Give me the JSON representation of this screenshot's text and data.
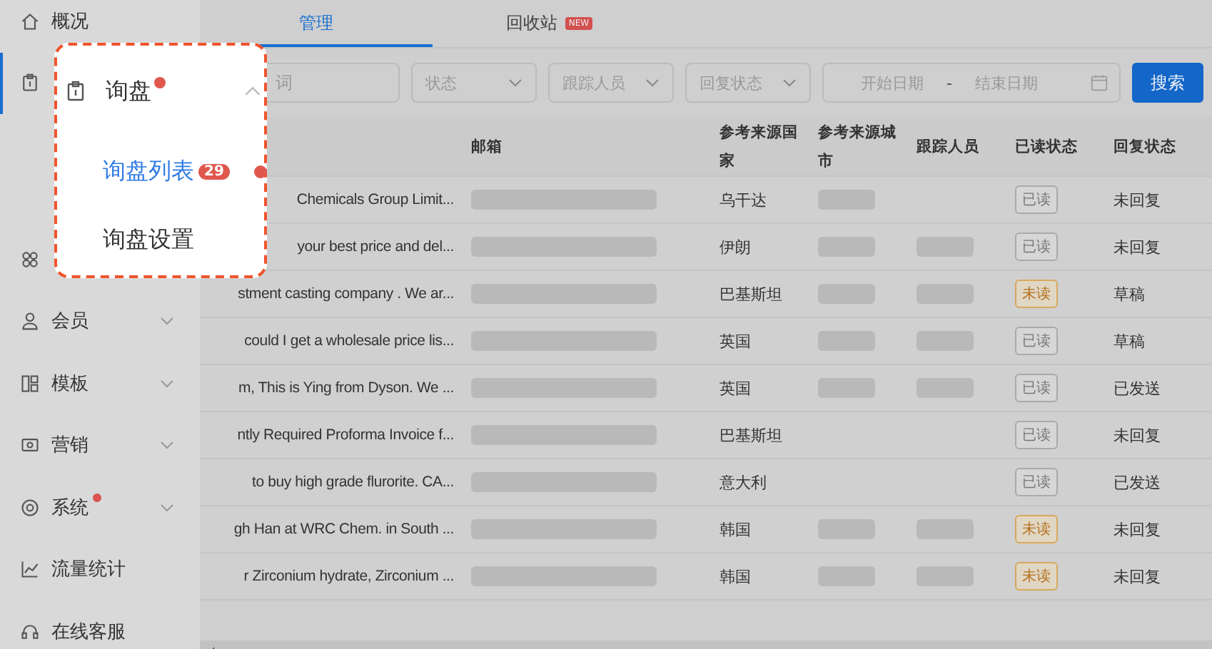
{
  "sidebar": {
    "items": [
      {
        "label": "概况",
        "selected": false,
        "submenu": false,
        "dot": false
      },
      {
        "selected": true
      },
      {
        "selected": false
      },
      {
        "label": "会员",
        "selected": false,
        "submenu": true,
        "dot": false
      },
      {
        "label": "模板",
        "selected": false,
        "submenu": true,
        "dot": false
      },
      {
        "label": "营销",
        "selected": false,
        "submenu": true,
        "dot": false
      },
      {
        "label": "系统",
        "selected": false,
        "submenu": true,
        "dot": true
      },
      {
        "label": "流量统计",
        "selected": false,
        "submenu": false,
        "dot": false
      },
      {
        "label": "在线客服",
        "selected": false,
        "submenu": false,
        "dot": false
      }
    ]
  },
  "popup_menu": {
    "label": "询盘",
    "dot": true,
    "expanded": true,
    "children": [
      {
        "label": "询盘列表",
        "badge": "29",
        "selected": true,
        "dot": true
      },
      {
        "label": "询盘设置",
        "selected": false,
        "dot": false
      }
    ]
  },
  "tabs": [
    {
      "label": "管理",
      "selected": true
    },
    {
      "label": "回收站",
      "badge": "NEW",
      "selected": false
    }
  ],
  "filters": {
    "keyword": {
      "placeholder": "词"
    },
    "selects": [
      {
        "placeholder": "状态"
      },
      {
        "placeholder": "跟踪人员"
      },
      {
        "placeholder": "回复状态"
      }
    ],
    "date_range": {
      "start_placeholder": "开始日期",
      "separator": "-",
      "end_placeholder": "结束日期"
    },
    "search_button": "搜索"
  },
  "table": {
    "columns": [
      "邮箱",
      "参考来源国家",
      "参考来源城市",
      "跟踪人员",
      "已读状态",
      "回复状态"
    ],
    "rows": [
      {
        "subject": "Chemicals Group Limit...",
        "email_redacted": true,
        "country": "乌干达",
        "city_redacted": true,
        "tracker_redacted": false,
        "read_status": {
          "label": "已读",
          "read": true
        },
        "reply_status": "未回复"
      },
      {
        "subject": "your best price and del...",
        "email_redacted": true,
        "country": "伊朗",
        "city_redacted": true,
        "tracker_redacted": true,
        "read_status": {
          "label": "已读",
          "read": true
        },
        "reply_status": "未回复"
      },
      {
        "subject": "stment casting company . We ar...",
        "email_redacted": true,
        "country": "巴基斯坦",
        "city_redacted": true,
        "tracker_redacted": true,
        "read_status": {
          "label": "未读",
          "read": false
        },
        "reply_status": "草稿"
      },
      {
        "subject": "could I get a wholesale price lis...",
        "email_redacted": true,
        "country": "英国",
        "city_redacted": true,
        "tracker_redacted": true,
        "read_status": {
          "label": "已读",
          "read": true
        },
        "reply_status": "草稿"
      },
      {
        "subject": "m, This is Ying from Dyson. We ...",
        "email_redacted": true,
        "country": "英国",
        "city_redacted": true,
        "tracker_redacted": true,
        "read_status": {
          "label": "已读",
          "read": true
        },
        "reply_status": "已发送"
      },
      {
        "subject": "ntly Required Proforma Invoice f...",
        "email_redacted": true,
        "country": "巴基斯坦",
        "city_redacted": false,
        "tracker_redacted": false,
        "read_status": {
          "label": "已读",
          "read": true
        },
        "reply_status": "未回复"
      },
      {
        "subject": "to buy high grade flurorite. CA...",
        "email_redacted": true,
        "country": "意大利",
        "city_redacted": false,
        "tracker_redacted": false,
        "read_status": {
          "label": "已读",
          "read": true
        },
        "reply_status": "已发送"
      },
      {
        "subject": "gh Han at WRC Chem. in South ...",
        "email_redacted": true,
        "country": "韩国",
        "city_redacted": true,
        "tracker_redacted": true,
        "read_status": {
          "label": "未读",
          "read": false
        },
        "reply_status": "未回复"
      },
      {
        "subject": "r Zirconium hydrate, Zirconium ...",
        "email_redacted": true,
        "country": "韩国",
        "city_redacted": true,
        "tracker_redacted": true,
        "read_status": {
          "label": "未读",
          "read": false
        },
        "reply_status": "未回复"
      }
    ]
  }
}
